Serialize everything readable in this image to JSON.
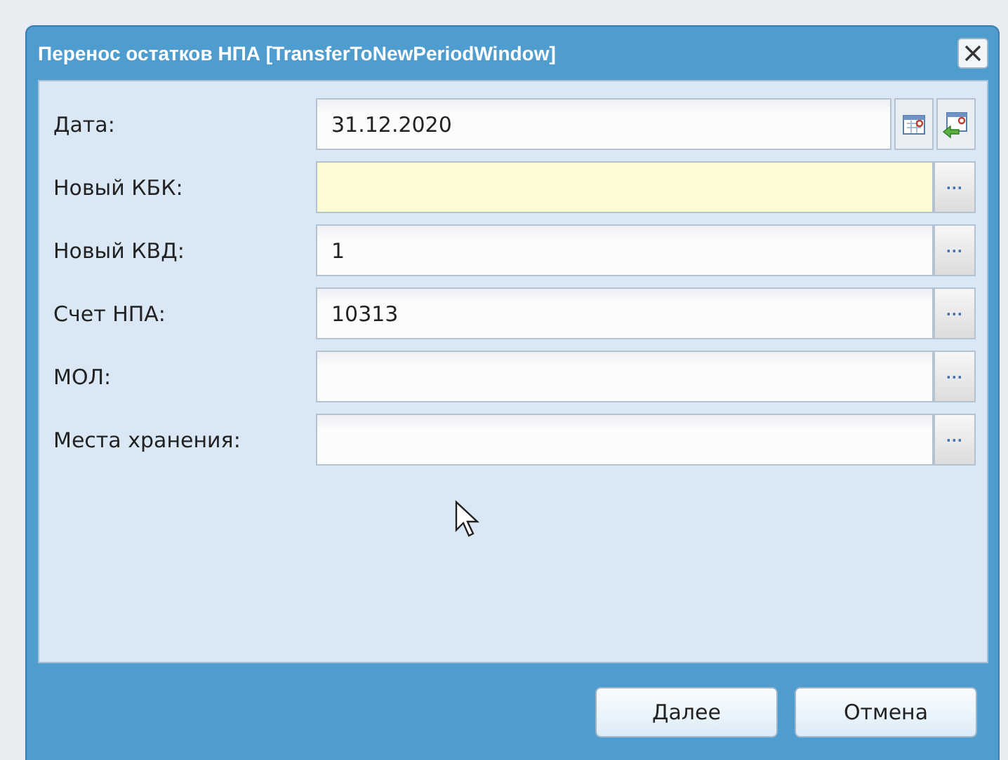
{
  "window": {
    "title": "Перенос остатков НПА [TransferToNewPeriodWindow]"
  },
  "fields": [
    {
      "label": "Дата:",
      "kind": "date",
      "value": "31.12.2020",
      "highlighted": false
    },
    {
      "label": "Новый КБК:",
      "kind": "lookup",
      "highlighted": true,
      "button": "···"
    },
    {
      "label": "Новый КВД:",
      "kind": "lookup",
      "value": "1",
      "highlighted": false,
      "button": "···"
    },
    {
      "label": "Счет НПА:",
      "kind": "lookup",
      "value": "10313",
      "highlighted": false,
      "button": "···"
    },
    {
      "label": "МОЛ:",
      "kind": "lookup",
      "highlighted": false,
      "button": "···"
    },
    {
      "label": "Места хранения:",
      "kind": "lookup",
      "highlighted": false,
      "button": "···"
    }
  ],
  "buttons": [
    "Далее",
    "Отмена"
  ]
}
